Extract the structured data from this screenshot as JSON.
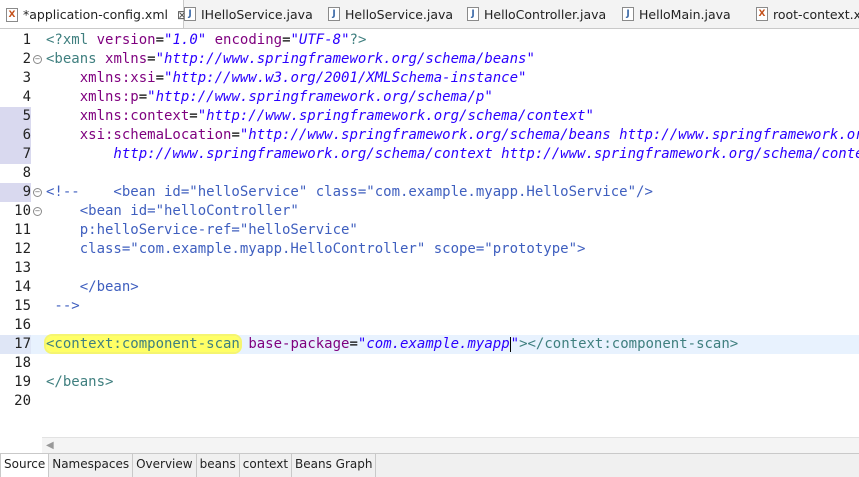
{
  "editor_tabs": [
    {
      "label": "*application-config.xml",
      "icon": "xml-file-icon",
      "active": true
    },
    {
      "label": "IHelloService.java",
      "icon": "java-file-icon"
    },
    {
      "label": "HelloService.java",
      "icon": "java-file-icon"
    },
    {
      "label": "HelloController.java",
      "icon": "java-file-icon"
    },
    {
      "label": "HelloMain.java",
      "icon": "java-file-icon"
    },
    {
      "label": "root-context.xml",
      "icon": "xml-file-icon"
    }
  ],
  "close_glyph": "⊠",
  "line_numbers": [
    "1",
    "2",
    "3",
    "4",
    "5",
    "6",
    "7",
    "8",
    "9",
    "10",
    "11",
    "12",
    "13",
    "14",
    "15",
    "16",
    "17",
    "18",
    "19",
    "20"
  ],
  "code_lines": [
    [
      [
        "<?xml ",
        "tag"
      ],
      [
        "version",
        "attr"
      ],
      [
        "=",
        "txt"
      ],
      [
        "\"1.0\"",
        "val"
      ],
      [
        " ",
        "txt"
      ],
      [
        "encoding",
        "attr"
      ],
      [
        "=",
        "txt"
      ],
      [
        "\"UTF-8\"",
        "val"
      ],
      [
        "?>",
        "tag"
      ]
    ],
    [
      [
        "<beans ",
        "tag"
      ],
      [
        "xmlns",
        "attr"
      ],
      [
        "=",
        "txt"
      ],
      [
        "\"http://www.springframework.org/schema/beans\"",
        "val"
      ]
    ],
    [
      [
        "    ",
        "txt"
      ],
      [
        "xmlns:xsi",
        "attr"
      ],
      [
        "=",
        "txt"
      ],
      [
        "\"http://www.w3.org/2001/XMLSchema-instance\"",
        "val"
      ]
    ],
    [
      [
        "    ",
        "txt"
      ],
      [
        "xmlns:p",
        "attr"
      ],
      [
        "=",
        "txt"
      ],
      [
        "\"http://www.springframework.org/schema/p\"",
        "val"
      ]
    ],
    [
      [
        "    ",
        "txt"
      ],
      [
        "xmlns:context",
        "attr"
      ],
      [
        "=",
        "txt"
      ],
      [
        "\"http://www.springframework.org/schema/context\"",
        "val"
      ]
    ],
    [
      [
        "    ",
        "txt"
      ],
      [
        "xsi:schemaLocation",
        "attr"
      ],
      [
        "=",
        "txt"
      ],
      [
        "\"http://www.springframework.org/schema/beans http://www.springframework.org/schema/beans/spring-beans.xsd",
        "val"
      ]
    ],
    [
      [
        "        http://www.springframework.org/schema/context http://www.springframework.org/schema/context/spring-context.xsd\">",
        "val"
      ]
    ],
    [],
    [
      [
        "<!--    <bean id=\"helloService\" class=\"com.example.myapp.HelloService\"/>",
        "com"
      ]
    ],
    [
      [
        "    <bean id=\"helloController\"",
        "com"
      ]
    ],
    [
      [
        "    p:helloService-ref=\"helloService\"",
        "com"
      ]
    ],
    [
      [
        "    class=\"com.example.myapp.HelloController\" scope=\"prototype\">",
        "com"
      ]
    ],
    [],
    [
      [
        "    </bean>",
        "com"
      ]
    ],
    [
      [
        " -->",
        "com"
      ]
    ],
    [],
    [
      [
        "<context:component-scan",
        "tag hl"
      ],
      [
        " ",
        "txt"
      ],
      [
        "base-package",
        "attr"
      ],
      [
        "=",
        "txt"
      ],
      [
        "\"com.example.myapp",
        "val"
      ],
      [
        "|caret",
        "caret"
      ],
      [
        "\"",
        "val"
      ],
      [
        "></context:component-scan>",
        "tag"
      ]
    ],
    [],
    [
      [
        "</beans>",
        "tag"
      ]
    ],
    []
  ],
  "bottom_tabs": [
    "Source",
    "Namespaces",
    "Overview",
    "beans",
    "context",
    "Beans Graph"
  ],
  "active_bottom_tab": "Source"
}
